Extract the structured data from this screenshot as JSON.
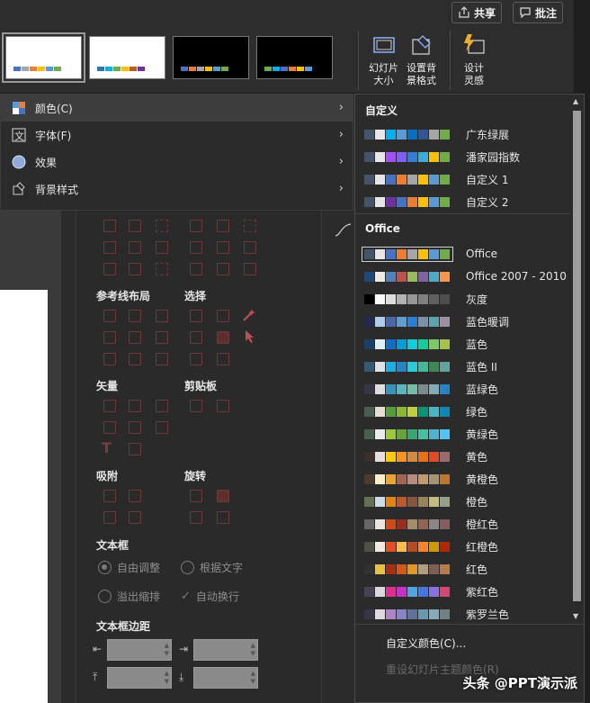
{
  "ribbon": {
    "share_label": "共享",
    "comment_label": "批注",
    "slide_size_label_1": "幻灯片",
    "slide_size_label_2": "大小",
    "format_bg_label_1": "设置背",
    "format_bg_label_2": "景格式",
    "designer_label_1": "设计",
    "designer_label_2": "灵感",
    "variants": [
      {
        "bg": "#ffffff",
        "colors": [
          "#4472c4",
          "#a5a5a5",
          "#ed7d31",
          "#ffc000",
          "#5b9bd5",
          "#70ad47"
        ]
      },
      {
        "bg": "#ffffff",
        "colors": [
          "#2e75b6",
          "#00b0f0",
          "#70ad47",
          "#ffc000",
          "#c55a11",
          "#7030a0"
        ]
      },
      {
        "bg": "#000000",
        "colors": [
          "#4472c4",
          "#ed7d31",
          "#a5a5a5",
          "#ffc000",
          "#5b9bd5",
          "#70ad47"
        ]
      },
      {
        "bg": "#000000",
        "colors": [
          "#70ad47",
          "#00b0f0",
          "#4472c4",
          "#ed7d31",
          "#ffc000",
          "#5b9bd5"
        ]
      }
    ]
  },
  "menu": {
    "items": [
      {
        "label": "颜色(C)",
        "icon": "color-palette-icon"
      },
      {
        "label": "字体(F)",
        "icon": "font-icon"
      },
      {
        "label": "效果",
        "icon": "effects-icon"
      },
      {
        "label": "背景样式",
        "icon": "background-style-icon"
      }
    ]
  },
  "panel": {
    "guide_layout": "参考线布局",
    "select": "选择",
    "vector": "矢量",
    "clipboard": "剪贴板",
    "eyedropper": "吸附",
    "rotate": "旋转",
    "textbox": "文本框",
    "auto_fit": "自由调整",
    "fit_text": "根据文字",
    "overflow": "溢出缩排",
    "auto_wrap": "自动换行",
    "textbox_margin": "文本框边距"
  },
  "dropdown": {
    "custom_header": "自定义",
    "office_header": "Office",
    "custom_schemes": [
      {
        "name": "广东绿展",
        "colors": [
          "#44546a",
          "#e7e6e6",
          "#00b0f0",
          "#5b9bd5",
          "#0070c0",
          "#2f5597",
          "#a5a5a5",
          "#70ad47"
        ]
      },
      {
        "name": "潘家园指数",
        "colors": [
          "#44546a",
          "#e7e6e6",
          "#a64dff",
          "#7f60ff",
          "#2f7ed8",
          "#3aaed8",
          "#ffc000",
          "#70ad47"
        ]
      },
      {
        "name": "自定义 1",
        "colors": [
          "#44546a",
          "#e7e6e6",
          "#4472c4",
          "#ed7d31",
          "#a5a5a5",
          "#ffc000",
          "#5b9bd5",
          "#70ad47"
        ]
      },
      {
        "name": "自定义 2",
        "colors": [
          "#44546a",
          "#e7e6e6",
          "#7030a0",
          "#4472c4",
          "#ed7d31",
          "#ffc000",
          "#5b9bd5",
          "#70ad47"
        ]
      }
    ],
    "office_schemes": [
      {
        "name": "Office",
        "colors": [
          "#44546a",
          "#e7e6e6",
          "#4472c4",
          "#ed7d31",
          "#a5a5a5",
          "#ffc000",
          "#5b9bd5",
          "#70ad47"
        ]
      },
      {
        "name": "Office 2007 - 2010",
        "colors": [
          "#1f497d",
          "#eeece1",
          "#4f81bd",
          "#c0504d",
          "#9bbb59",
          "#8064a2",
          "#4bacc6",
          "#f79646"
        ]
      },
      {
        "name": "灰度",
        "colors": [
          "#000000",
          "#f8f8f8",
          "#dddddd",
          "#b2b2b2",
          "#969696",
          "#808080",
          "#5f5f5f",
          "#4d4d4d"
        ]
      },
      {
        "name": "蓝色暖调",
        "colors": [
          "#242852",
          "#acccea",
          "#4a66ac",
          "#629dd1",
          "#297fd5",
          "#7f8fa9",
          "#5aa2ae",
          "#9d90a0"
        ]
      },
      {
        "name": "蓝色",
        "colors": [
          "#17406d",
          "#dbefff",
          "#0f6fc6",
          "#009dd9",
          "#0bd0d9",
          "#10cf9b",
          "#7cca62",
          "#a5c249"
        ]
      },
      {
        "name": "蓝色 II",
        "colors": [
          "#335b74",
          "#dfe3e5",
          "#1cade4",
          "#2683c6",
          "#27ced7",
          "#42ba97",
          "#3e8853",
          "#62a39f"
        ]
      },
      {
        "name": "蓝绿色",
        "colors": [
          "#373545",
          "#dedede",
          "#3494ba",
          "#58b6c0",
          "#75bda7",
          "#7a8c8e",
          "#84acb6",
          "#2683c6"
        ]
      },
      {
        "name": "绿色",
        "colors": [
          "#455f51",
          "#e3ded1",
          "#549e39",
          "#8ab833",
          "#c0cf3a",
          "#029676",
          "#4ab5c4",
          "#0989b1"
        ]
      },
      {
        "name": "黄绿色",
        "colors": [
          "#455f51",
          "#ebebeb",
          "#99cb38",
          "#63a537",
          "#37a76f",
          "#44c1a3",
          "#4eb3cf",
          "#51c3f9"
        ]
      },
      {
        "name": "黄色",
        "colors": [
          "#39302a",
          "#e5dedb",
          "#ffca08",
          "#f8931d",
          "#ce8d3e",
          "#ec7016",
          "#e64823",
          "#9c6a6a"
        ]
      },
      {
        "name": "黄橙色",
        "colors": [
          "#4e3b30",
          "#fbeec9",
          "#f0a22e",
          "#a5644e",
          "#b58b80",
          "#c3986d",
          "#a19574",
          "#c17529"
        ]
      },
      {
        "name": "橙色",
        "colors": [
          "#637052",
          "#ccddea",
          "#e48312",
          "#bd582c",
          "#865640",
          "#9b8357",
          "#c2bc80",
          "#94a088"
        ]
      },
      {
        "name": "橙红色",
        "colors": [
          "#696464",
          "#e9e5dc",
          "#d34817",
          "#9b2d1f",
          "#a28e6a",
          "#956251",
          "#918485",
          "#855d5d"
        ]
      },
      {
        "name": "红橙色",
        "colors": [
          "#505046",
          "#eeece1",
          "#e84c22",
          "#ffbd47",
          "#b64926",
          "#ff8427",
          "#cc9900",
          "#b22600"
        ]
      },
      {
        "name": "红色",
        "colors": [
          "#323232",
          "#e5c243",
          "#a5300f",
          "#d55816",
          "#e19825",
          "#b19c7d",
          "#7f5f52",
          "#b27d49"
        ]
      },
      {
        "name": "紫红色",
        "colors": [
          "#454551",
          "#d8d9dc",
          "#e32d91",
          "#c830cc",
          "#4ea6dc",
          "#4775e7",
          "#8971e1",
          "#d54773"
        ]
      },
      {
        "name": "紫罗兰色",
        "colors": [
          "#373545",
          "#dcd8dc",
          "#ad84c6",
          "#8784c7",
          "#5d739a",
          "#6997af",
          "#84acb6",
          "#6f8183"
        ]
      }
    ],
    "customize_colors": "自定义颜色(C)...",
    "reset_colors": "重设幻灯片主题颜色(R)"
  },
  "watermark": "头条 @PPT演示派"
}
